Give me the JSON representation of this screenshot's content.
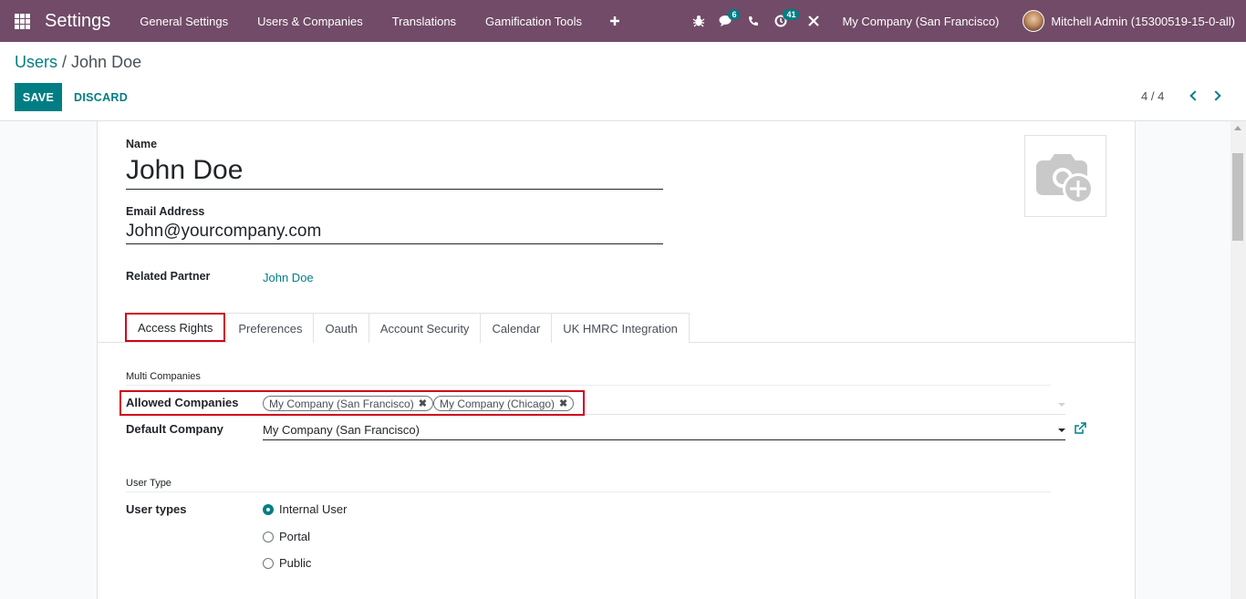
{
  "navbar": {
    "app_title": "Settings",
    "menu": [
      "General Settings",
      "Users & Companies",
      "Translations",
      "Gamification Tools"
    ],
    "messages_count": "6",
    "activities_count": "41",
    "company": "My Company (San Francisco)",
    "user": "Mitchell Admin (15300519-15-0-all)"
  },
  "control": {
    "breadcrumb_parent": "Users",
    "breadcrumb_sep": " / ",
    "breadcrumb_current": "John Doe",
    "save_label": "SAVE",
    "discard_label": "DISCARD",
    "pager": "4 / 4"
  },
  "form": {
    "name_label": "Name",
    "name_value": "John Doe",
    "email_label": "Email Address",
    "email_value": "John@yourcompany.com",
    "partner_label": "Related Partner",
    "partner_value": "John Doe"
  },
  "tabs": [
    "Access Rights",
    "Preferences",
    "Oauth",
    "Account Security",
    "Calendar",
    "UK HMRC Integration"
  ],
  "access": {
    "multi_companies_title": "Multi Companies",
    "allowed_label": "Allowed Companies",
    "allowed_tags": [
      "My Company (San Francisco)",
      "My Company (Chicago)"
    ],
    "default_label": "Default Company",
    "default_value": "My Company (San Francisco)",
    "user_type_title": "User Type",
    "user_types_label": "User types",
    "user_types": [
      "Internal User",
      "Portal",
      "Public"
    ],
    "selected_user_type": "Internal User"
  },
  "colors": {
    "navbar": "#714B67",
    "accent": "#017E84",
    "highlight": "#d0021b"
  }
}
